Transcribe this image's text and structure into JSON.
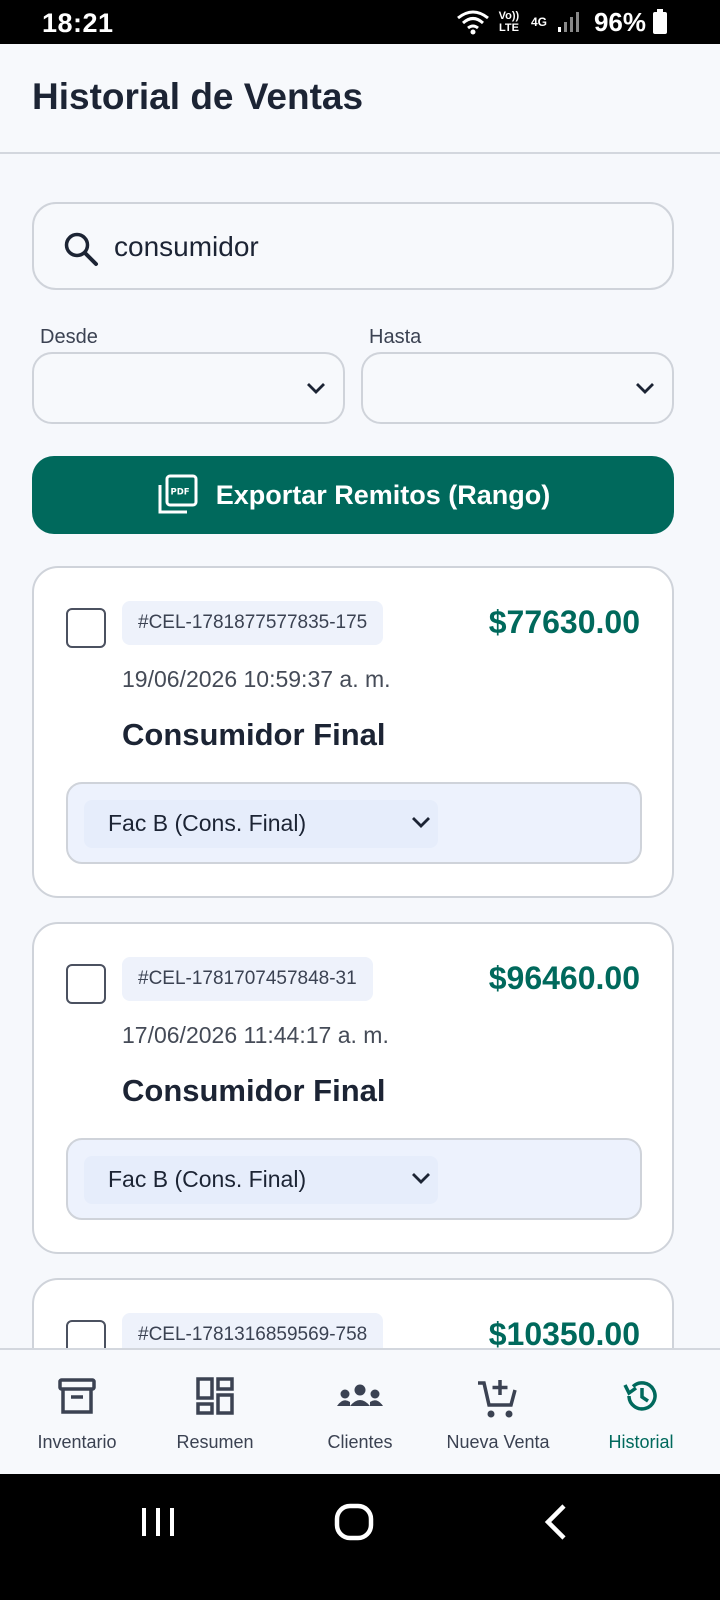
{
  "status_bar": {
    "time": "18:21",
    "network_volte": "Vo)) LTE",
    "network_4g": "4G",
    "battery": "96%"
  },
  "header": {
    "title": "Historial de Ventas"
  },
  "search": {
    "value": "consumidor",
    "icon": "search-icon"
  },
  "filters": {
    "desde_label": "Desde",
    "hasta_label": "Hasta",
    "desde_value": "",
    "hasta_value": ""
  },
  "export": {
    "label": "Exportar Remitos (Rango)",
    "icon": "pdf-icon"
  },
  "sales": [
    {
      "code": "#CEL-1781877577835-175",
      "amount": "$77630.00",
      "date": "19/06/2026 10:59:37 a. m.",
      "client": "Consumidor Final",
      "invoice_type": "Fac B (Cons. Final)",
      "checked": false
    },
    {
      "code": "#CEL-1781707457848-31",
      "amount": "$96460.00",
      "date": "17/06/2026 11:44:17 a. m.",
      "client": "Consumidor Final",
      "invoice_type": "Fac B (Cons. Final)",
      "checked": false
    },
    {
      "code": "#CEL-1781316859569-758",
      "amount": "$10350.00",
      "checked": false
    }
  ],
  "bottom_nav": [
    {
      "label": "Inventario",
      "icon": "archive-box-icon",
      "active": false
    },
    {
      "label": "Resumen",
      "icon": "dashboard-grid-icon",
      "active": false
    },
    {
      "label": "Clientes",
      "icon": "people-group-icon",
      "active": false
    },
    {
      "label": "Nueva Venta",
      "icon": "cart-add-icon",
      "active": false
    },
    {
      "label": "Historial",
      "icon": "history-icon",
      "active": true
    }
  ],
  "colors": {
    "accent": "#00695c",
    "text": "#1c2434",
    "background": "#f6f8fc",
    "border": "#cfd3da"
  }
}
